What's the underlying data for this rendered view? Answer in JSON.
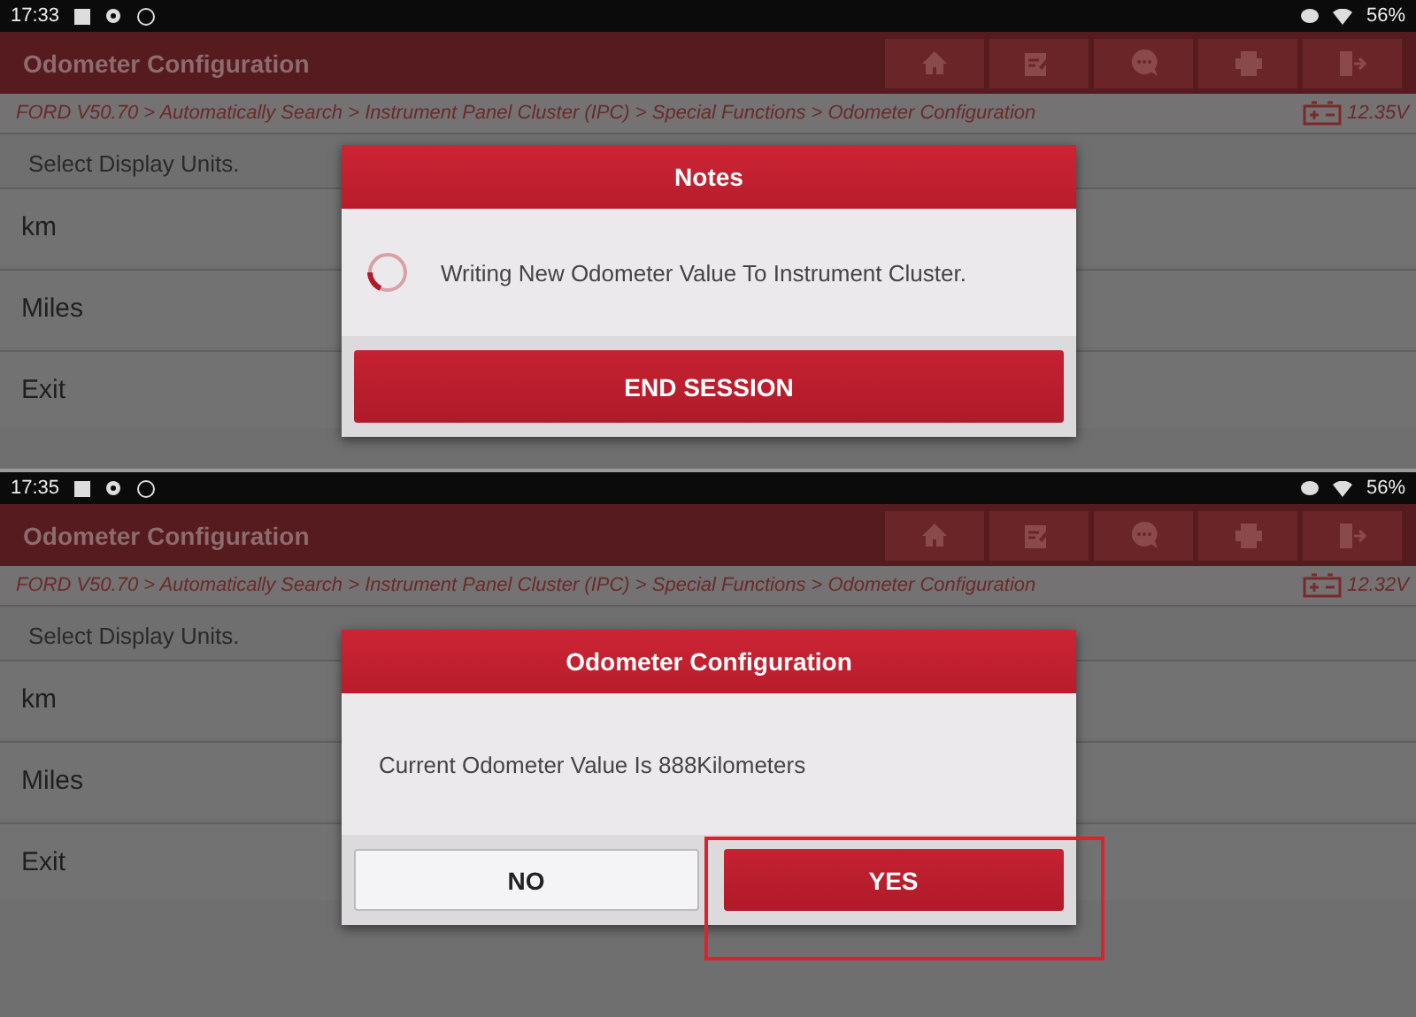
{
  "screens": [
    {
      "status_bar": {
        "time": "17:33",
        "battery": "56%"
      },
      "title": "Odometer Configuration",
      "breadcrumb": "FORD V50.70 > Automatically Search > Instrument Panel Cluster (IPC) > Special Functions > Odometer Configuration",
      "voltage": "12.35V",
      "list_header": "Select Display Units.",
      "items": [
        "km",
        "Miles",
        "Exit"
      ],
      "dialog": {
        "title": "Notes",
        "kind": "progress",
        "message": "Writing New Odometer Value To Instrument Cluster.",
        "buttons": [
          {
            "label": "END SESSION",
            "kind": "primary"
          }
        ]
      }
    },
    {
      "status_bar": {
        "time": "17:35",
        "battery": "56%"
      },
      "title": "Odometer Configuration",
      "breadcrumb": "FORD V50.70 > Automatically Search > Instrument Panel Cluster (IPC) > Special Functions > Odometer Configuration",
      "voltage": "12.32V",
      "list_header": "Select Display Units.",
      "items": [
        "km",
        "Miles",
        "Exit"
      ],
      "dialog": {
        "title": "Odometer Configuration",
        "kind": "message",
        "message": "Current Odometer Value Is 888Kilometers",
        "buttons": [
          {
            "label": "NO",
            "kind": "secondary"
          },
          {
            "label": "YES",
            "kind": "primary",
            "highlighted": true
          }
        ]
      }
    }
  ]
}
